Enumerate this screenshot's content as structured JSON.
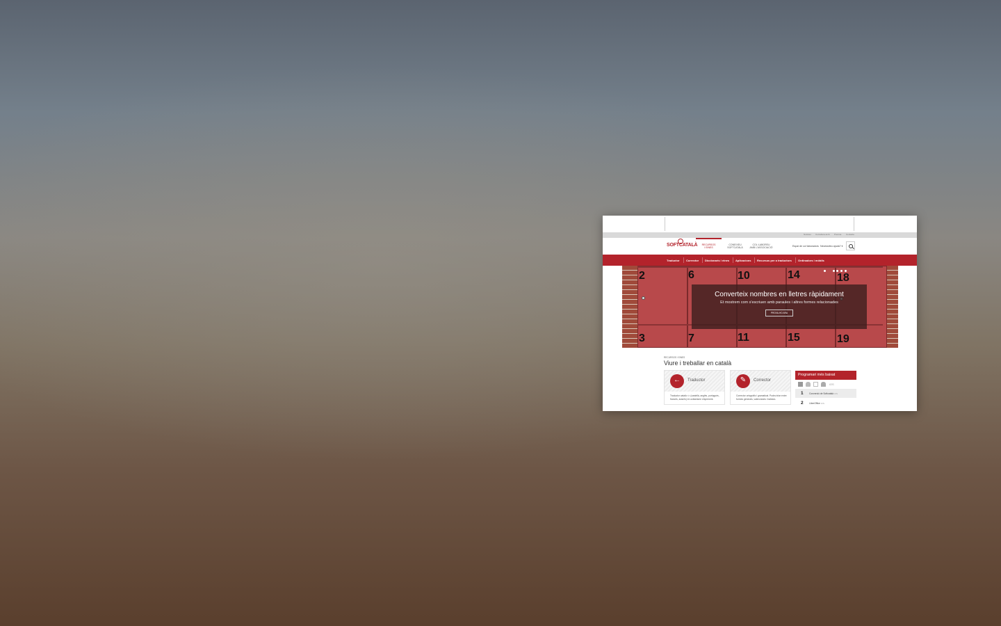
{
  "screenshot": {
    "utility_links": [
      "Notícies",
      "Col·labora amb",
      "Premsa",
      "Contacte"
    ],
    "nav": {
      "logo": "SOFTCATALÀ",
      "main_items": [
        {
          "line1": "RECURSOS",
          "line2": "I EINES",
          "active": true
        },
        {
          "line1": "CONEIXEU",
          "line2": "SOFTCATALÀ",
          "active": false
        },
        {
          "line1": "COL·LABOREU",
          "line2": "AMB L'ASSOCIACIÓ",
          "active": false
        }
      ],
      "espai_link": "Espai de col·laboradors",
      "help_link": "Necessiteu ajuda?",
      "help_arrow": "▾",
      "search_icon": "search-icon"
    },
    "subnav": [
      "Traductor",
      "Corrector",
      "Diccionaris i eines",
      "Aplicacions",
      "Recursos per a traductors",
      "Ordinadors i mòbils"
    ],
    "hero": {
      "numbers_top": [
        "2",
        "6",
        "10",
        "14",
        "18"
      ],
      "numbers_bottom": [
        "3",
        "7",
        "11",
        "15",
        "19"
      ],
      "title": "Converteix nombres en lletres ràpidament",
      "subtitle": "Et mostrem com s'escriuen amb paraules i altres formes relacionades",
      "button": "PROVA-HO ARA",
      "slides": 5
    },
    "section": {
      "breadcrumb": "RECURSOS I EINES",
      "title": "Viure i treballar en català"
    },
    "cards": [
      {
        "title": "Traductor",
        "icon": "arrow-left-icon",
        "glyph": "←",
        "desc": "Traductor català <> (castellà, anglès, portuguès, francès, aranès) en ocitanisme d'aprenent."
      },
      {
        "title": "Corrector",
        "icon": "stamp-icon",
        "glyph": "✎",
        "desc": "Corrector ortogràfic i gramatical. Podeu triar entre formes generals, valencianes i balears."
      }
    ],
    "widget": {
      "title": "Programari més baixat",
      "os_label": "iOS",
      "items": [
        {
          "rank": "1",
          "name": "Conversió de Softcatalà",
          "os": "iOS"
        },
        {
          "rank": "2",
          "name": "LibreOffice",
          "os": "iOS"
        }
      ]
    },
    "colors": {
      "brand": "#b3232b",
      "door": "#b8494b"
    }
  }
}
